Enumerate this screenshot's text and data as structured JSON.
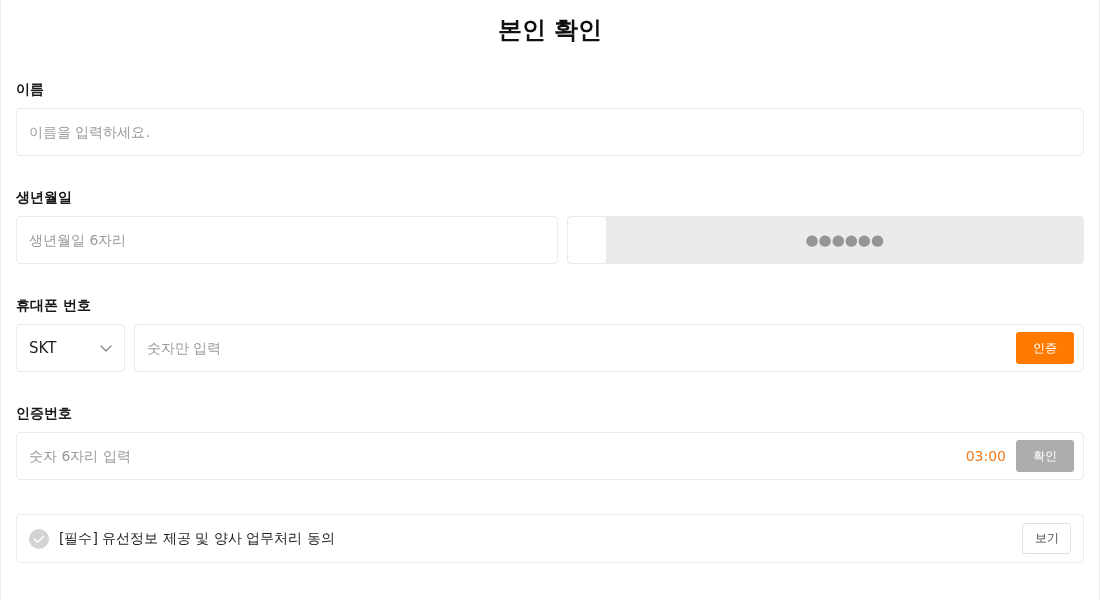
{
  "title": "본인 확인",
  "name": {
    "label": "이름",
    "placeholder": "이름을 입력하세요."
  },
  "birth": {
    "label": "생년월일",
    "placeholder": "생년월일 6자리",
    "masked": "●●●●●●"
  },
  "phone": {
    "label": "휴대폰 번호",
    "carrier": "SKT",
    "placeholder": "숫자만 입력",
    "button": {
      "label": "인증",
      "disabled": false
    }
  },
  "code": {
    "label": "인증번호",
    "placeholder": "숫자 6자리 입력",
    "timer": "03:00",
    "button": {
      "label": "확인",
      "disabled": true
    }
  },
  "agreement": {
    "checked": false,
    "text": "[필수] 유선정보 제공 및 양사 업무처리 동의",
    "view_button": "보기"
  }
}
